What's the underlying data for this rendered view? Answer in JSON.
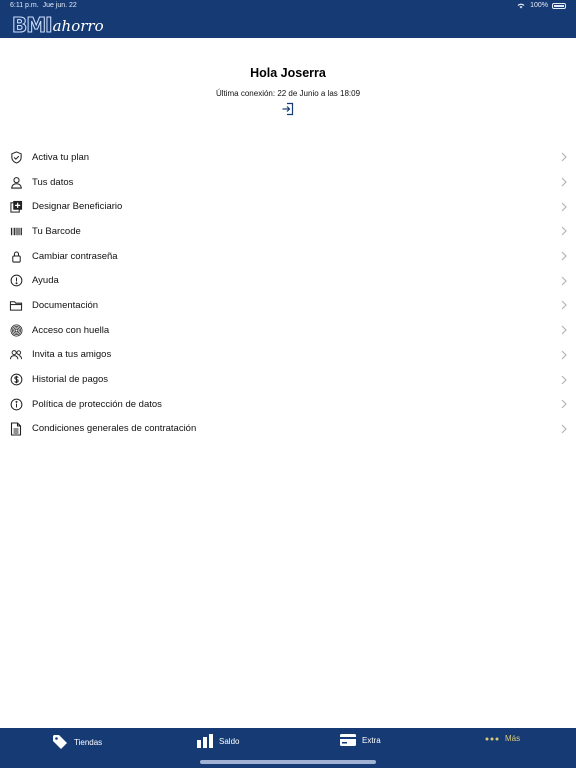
{
  "status_bar": {
    "time": "6:11 p.m.",
    "date": "Jue jun. 22",
    "battery": "100%"
  },
  "header": {
    "logo_main": "BMI",
    "logo_sub": "ahorro"
  },
  "profile": {
    "greeting": "Hola Joserra",
    "last_connection": "Última conexión: 22 de Junio a las 18:09",
    "login_icon": "login-icon"
  },
  "menu": {
    "items": [
      {
        "label": "Activa tu plan",
        "icon": "shield-check-icon"
      },
      {
        "label": "Tus datos",
        "icon": "person-icon"
      },
      {
        "label": "Designar Beneficiario",
        "icon": "add-beneficiary-icon"
      },
      {
        "label": "Tu Barcode",
        "icon": "barcode-icon"
      },
      {
        "label": "Cambiar contraseña",
        "icon": "lock-icon"
      },
      {
        "label": "Ayuda",
        "icon": "exclamation-circle-icon"
      },
      {
        "label": "Documentación",
        "icon": "folder-icon"
      },
      {
        "label": "Acceso con huella",
        "icon": "fingerprint-icon"
      },
      {
        "label": "Invita a tus amigos",
        "icon": "people-icon"
      },
      {
        "label": "Historial de pagos",
        "icon": "dollar-circle-icon"
      },
      {
        "label": "Política de protección de datos",
        "icon": "info-circle-icon"
      },
      {
        "label": "Condiciones generales de contratación",
        "icon": "document-icon"
      }
    ]
  },
  "tabbar": {
    "tabs": [
      {
        "label": "Tiendas",
        "icon": "tag-icon"
      },
      {
        "label": "Saldo",
        "icon": "bar-chart-icon"
      },
      {
        "label": "Extra",
        "icon": "card-icon"
      },
      {
        "label": "Más",
        "icon": "more-dots-icon"
      }
    ],
    "active": "Más"
  },
  "colors": {
    "brand": "#163a73",
    "active_tab": "#d9ca7a",
    "background": "#ffffff"
  }
}
